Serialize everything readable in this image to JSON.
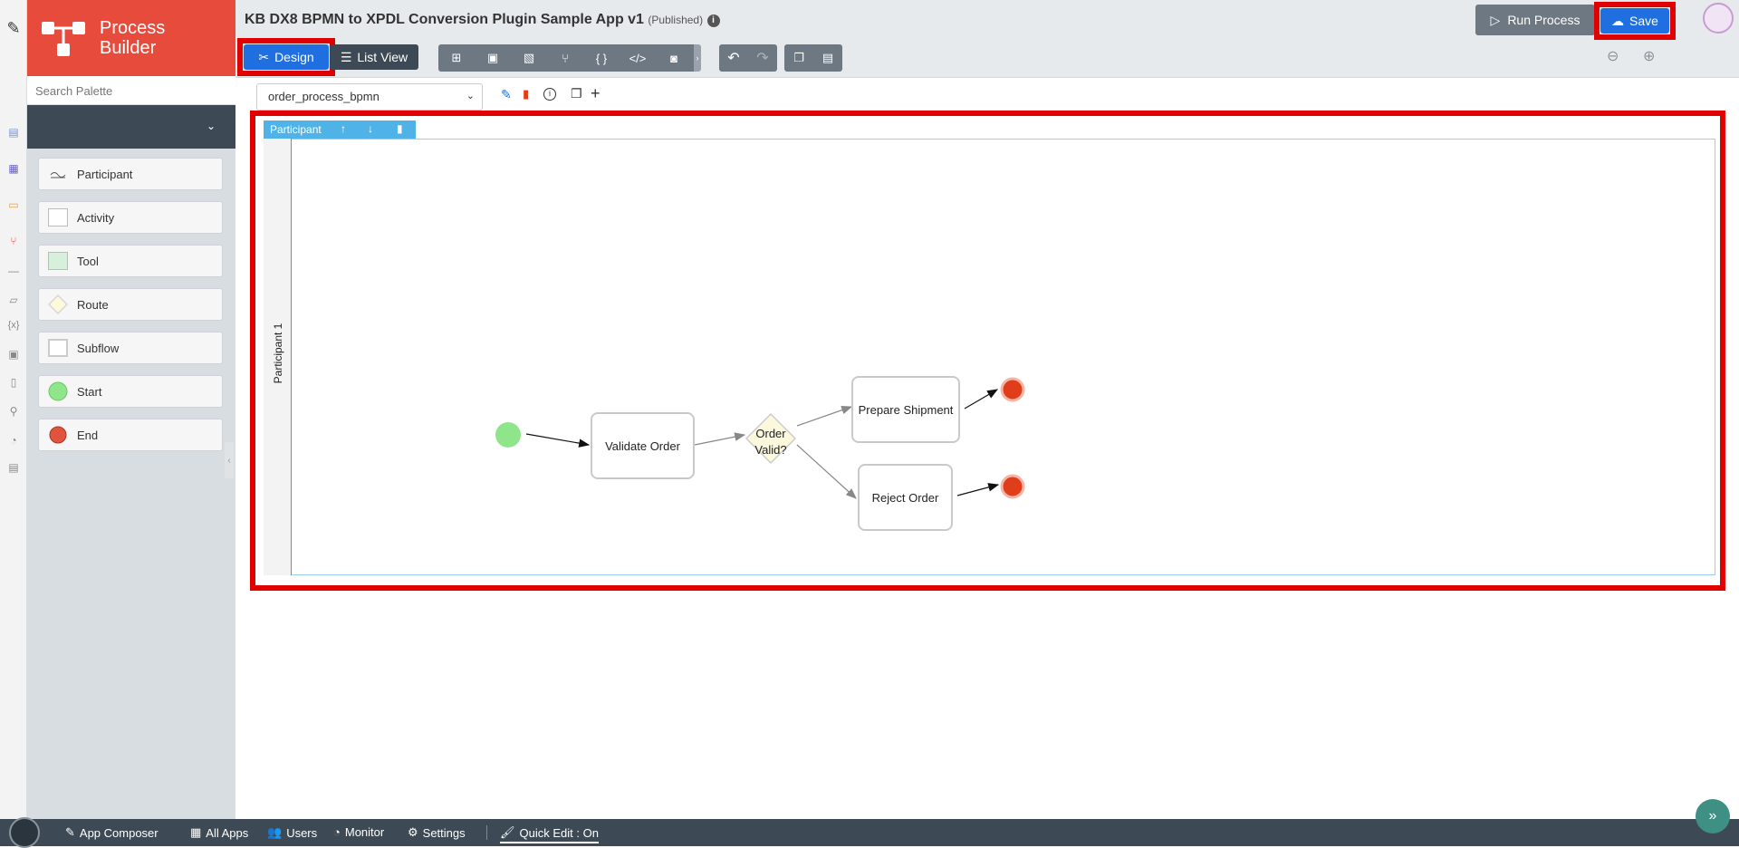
{
  "app": {
    "title": "KB DX8 BPMN to XPDL Conversion Plugin Sample App v1",
    "status": "(Published)"
  },
  "palette": {
    "title_line1": "Process",
    "title_line2": "Builder",
    "search_placeholder": "Search Palette",
    "items": [
      {
        "label": "Participant"
      },
      {
        "label": "Activity"
      },
      {
        "label": "Tool"
      },
      {
        "label": "Route"
      },
      {
        "label": "Subflow"
      },
      {
        "label": "Start"
      },
      {
        "label": "End"
      }
    ]
  },
  "toolbar": {
    "design_label": "Design",
    "list_view_label": "List View",
    "run_process_label": "Run Process",
    "save_label": "Save"
  },
  "process": {
    "selected": "order_process_bpmn"
  },
  "diagram": {
    "participant_tag": "Participant",
    "lane_label": "Participant 1",
    "nodes": {
      "validate": "Validate Order",
      "route": "Order Valid?",
      "prepare": "Prepare Shipment",
      "reject": "Reject Order"
    }
  },
  "bottombar": {
    "app_composer": "App Composer",
    "all_apps": "All Apps",
    "users": "Users",
    "monitor": "Monitor",
    "settings": "Settings",
    "quick_edit": "Quick Edit : On"
  },
  "colors": {
    "brand": "#e64b3c",
    "primary_button": "#1f6fe0",
    "highlight": "#e10000",
    "start": "#8fe68a",
    "end": "#e03d1a"
  }
}
